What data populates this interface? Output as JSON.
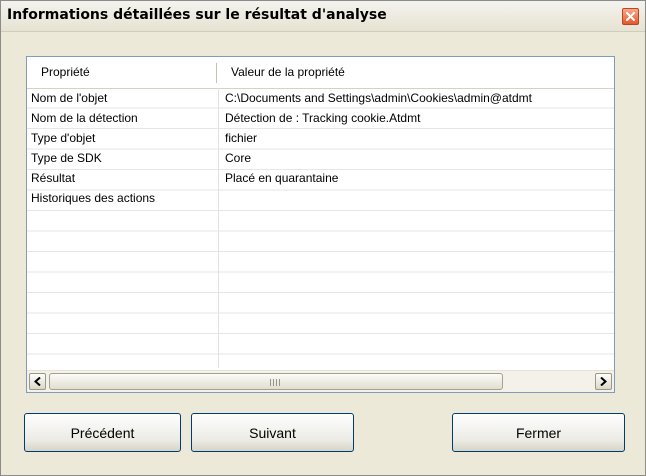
{
  "window": {
    "title": "Informations détaillées sur le résultat d'analyse"
  },
  "table": {
    "columns": [
      "Propriété",
      "Valeur de la propriété"
    ],
    "rows": [
      {
        "property": "Nom de l'objet",
        "value": "C:\\Documents and Settings\\admin\\Cookies\\admin@atdmt"
      },
      {
        "property": "Nom de la détection",
        "value": "Détection de : Tracking cookie.Atdmt"
      },
      {
        "property": "Type d'objet",
        "value": "fichier"
      },
      {
        "property": "Type de SDK",
        "value": "Core"
      },
      {
        "property": "Résultat",
        "value": "Placé en quarantaine"
      },
      {
        "property": "Historiques des actions",
        "value": ""
      }
    ]
  },
  "buttons": {
    "previous": "Précédent",
    "next": "Suivant",
    "close": "Fermer"
  },
  "icons": {
    "close": "close-icon",
    "scroll_left": "arrow-left-icon",
    "scroll_right": "arrow-right-icon",
    "thumb_grip": "grip-icon"
  },
  "colors": {
    "dialog_bg": "#ece9d8",
    "close_button": "#e5582b",
    "list_border": "#7f9db9",
    "button_border": "#003c74"
  }
}
